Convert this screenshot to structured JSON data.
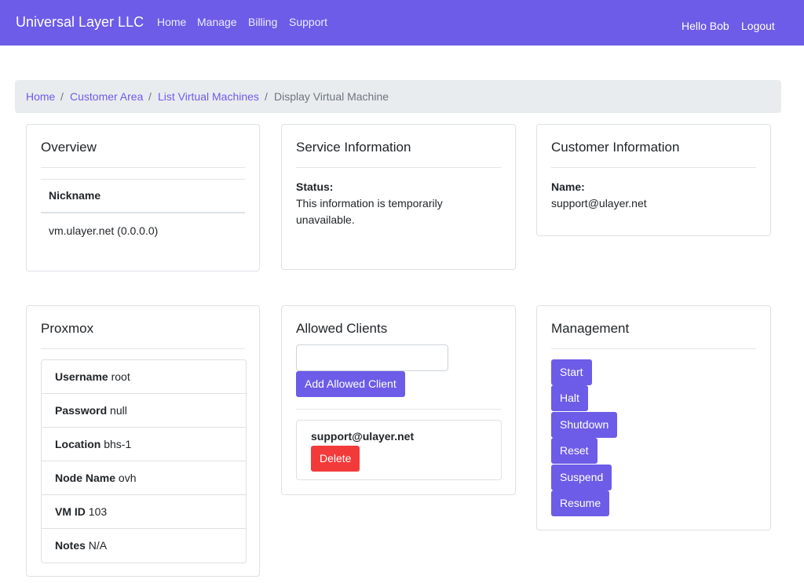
{
  "navbar": {
    "brand": "Universal Layer LLC",
    "links": [
      "Home",
      "Manage",
      "Billing",
      "Support"
    ],
    "greeting": "Hello Bob",
    "logout": "Logout",
    "color": "#6c5ce7"
  },
  "breadcrumb": {
    "items": [
      "Home",
      "Customer Area",
      "List Virtual Machines"
    ],
    "active": "Display Virtual Machine",
    "separator": "/"
  },
  "overview": {
    "title": "Overview",
    "column_header": "Nickname",
    "value": "vm.ulayer.net (0.0.0.0)"
  },
  "service": {
    "title": "Service Information",
    "status_label": "Status:",
    "status_line1": "This information is temporarily",
    "status_line2": "unavailable."
  },
  "customer": {
    "title": "Customer Information",
    "name_label": "Name:",
    "name_value": "support@ulayer.net"
  },
  "proxmox": {
    "title": "Proxmox",
    "rows": [
      {
        "key": "Username",
        "value": "root"
      },
      {
        "key": "Password",
        "value": "null"
      },
      {
        "key": "Location",
        "value": "bhs-1"
      },
      {
        "key": "Node Name",
        "value": "ovh"
      },
      {
        "key": "VM ID",
        "value": "103"
      },
      {
        "key": "Notes",
        "value": "N/A"
      }
    ]
  },
  "allowed_clients": {
    "title": "Allowed Clients",
    "input_value": "",
    "add_button": "Add Allowed Client",
    "clients": [
      {
        "email": "support@ulayer.net",
        "delete_label": "Delete"
      }
    ]
  },
  "management": {
    "title": "Management",
    "buttons": [
      "Start",
      "Halt",
      "Shutdown",
      "Reset",
      "Suspend",
      "Resume"
    ]
  },
  "colors": {
    "primary": "#6c5ce7",
    "danger": "#f33a3a",
    "breadcrumb_bg": "#e9ecef"
  }
}
